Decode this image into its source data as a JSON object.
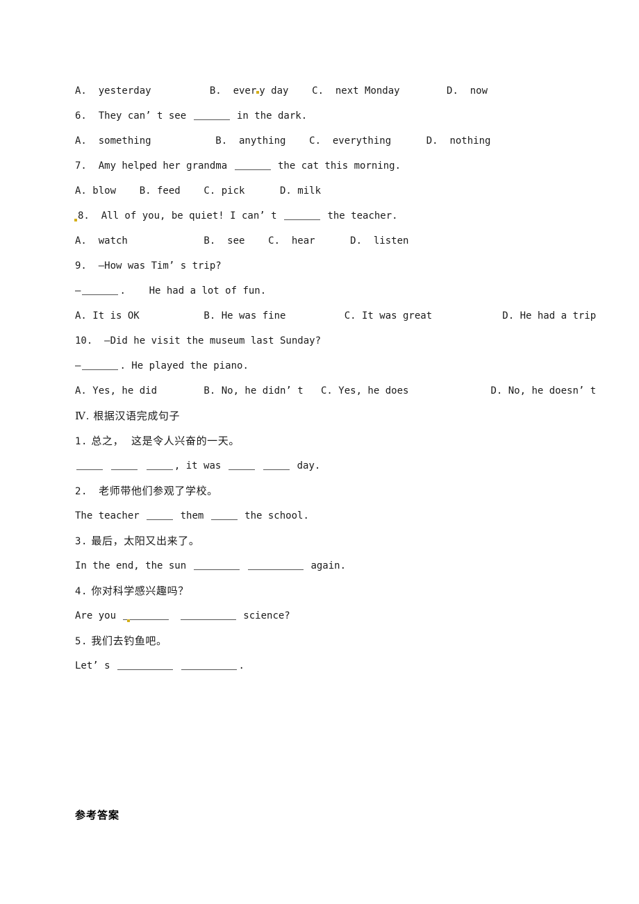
{
  "document": {
    "type": "english-exam-worksheet",
    "language": "en-zh",
    "page_background": "#ffffff",
    "text_color": "#1a1a1a",
    "highlight_mark_color": "#d4af1a"
  },
  "section_3_options_continued": {
    "q5_options": "A. yesterday          B. ever",
    "q5_options_tail": "y day    C. next Monday        D. now"
  },
  "questions": [
    {
      "id": "q5-options",
      "kind": "options",
      "text_before_mark": "A.  yesterday          B.  ever",
      "text_after_mark": "y day    C.  next Monday        D.  now",
      "has_mark": true
    },
    {
      "id": "q6-stem",
      "kind": "stem",
      "prefix": "6.  They can’ t see ",
      "suffix": " in the dark.",
      "blanks": [
        "b-md"
      ]
    },
    {
      "id": "q6-options",
      "kind": "options",
      "text": "A.  something           B.  anything    C.  everything      D.  nothing"
    },
    {
      "id": "q7-stem",
      "kind": "stem",
      "prefix": "7.  Amy helped her grandma ",
      "suffix": " the cat this morning.",
      "blanks": [
        "b-md"
      ]
    },
    {
      "id": "q7-options",
      "kind": "options",
      "text": "A. blow    B. feed    C. pick      D. milk"
    },
    {
      "id": "q8-stem",
      "kind": "stem-marked",
      "prefix": "8.  All of you, be quiet! I can’ t ",
      "suffix": " the teacher.",
      "blanks": [
        "b-md"
      ],
      "has_leading_mark": true
    },
    {
      "id": "q8-options",
      "kind": "options",
      "text": "A.  watch             B.  see    C.  hear      D.  listen"
    },
    {
      "id": "q9-stem",
      "kind": "stem",
      "text": "9.  —How was Tim’ s trip?"
    },
    {
      "id": "q9-reply",
      "kind": "stem",
      "prefix": "—",
      "suffix": ".    He had a lot of fun.",
      "blanks": [
        "b-md"
      ]
    },
    {
      "id": "q9-options",
      "kind": "options",
      "text": "A. It is OK           B. He was fine          C. It was great            D. He had a trip"
    },
    {
      "id": "q10-stem",
      "kind": "stem",
      "text": "10.  —Did he visit the museum last Sunday?"
    },
    {
      "id": "q10-reply",
      "kind": "stem",
      "prefix": "—",
      "suffix": ". He played the piano.",
      "blanks": [
        "b-md"
      ]
    },
    {
      "id": "q10-options",
      "kind": "options",
      "text": "A. Yes, he did        B. No, he didn’ t   C. Yes, he does              D. No, he doesn’ t"
    }
  ],
  "section_4": {
    "heading_roman": "Ⅳ.",
    "heading_text": " 根据汉语完成句子",
    "items": [
      {
        "id": "s4-1-cn",
        "number": "1.",
        "chinese": " 总之，  这是令人兴奋的一天。"
      },
      {
        "id": "s4-1-en",
        "segments": [
          "",
          " ",
          " ",
          ", it was ",
          " ",
          " day."
        ],
        "blanks": [
          "b-sm",
          "b-sm",
          "b-sm",
          "b-sm",
          "b-sm"
        ]
      },
      {
        "id": "s4-2-cn",
        "number": "2.",
        "chinese": "   老师带他们参观了学校。"
      },
      {
        "id": "s4-2-en",
        "prefix": "The teacher ",
        "middle": " them ",
        "suffix": " the school.",
        "blanks": [
          "b-sm",
          "b-sm"
        ]
      },
      {
        "id": "s4-3-cn",
        "number": "3.",
        "chinese": " 最后，太阳又出来了。"
      },
      {
        "id": "s4-3-en",
        "prefix": "In the end, the sun ",
        "middle": " ",
        "suffix": " again.",
        "blanks": [
          "b-lg",
          "b-xl"
        ]
      },
      {
        "id": "s4-4-cn",
        "number": "4.",
        "chinese": " 你对科学感兴趣吗？"
      },
      {
        "id": "s4-4-en",
        "prefix": "Are you ",
        "middle": " ",
        "suffix": " science?",
        "blanks": [
          "b-lg",
          "b-xl"
        ],
        "has_mark_in_first_blank": true
      },
      {
        "id": "s4-5-cn",
        "number": "5.",
        "chinese": " 我们去钓鱼吧。"
      },
      {
        "id": "s4-5-en",
        "prefix": "Let’ s ",
        "middle": " ",
        "suffix": ".",
        "blanks": [
          "b-xl",
          "b-xl"
        ]
      }
    ]
  },
  "footer": {
    "answers_heading": "参考答案"
  }
}
